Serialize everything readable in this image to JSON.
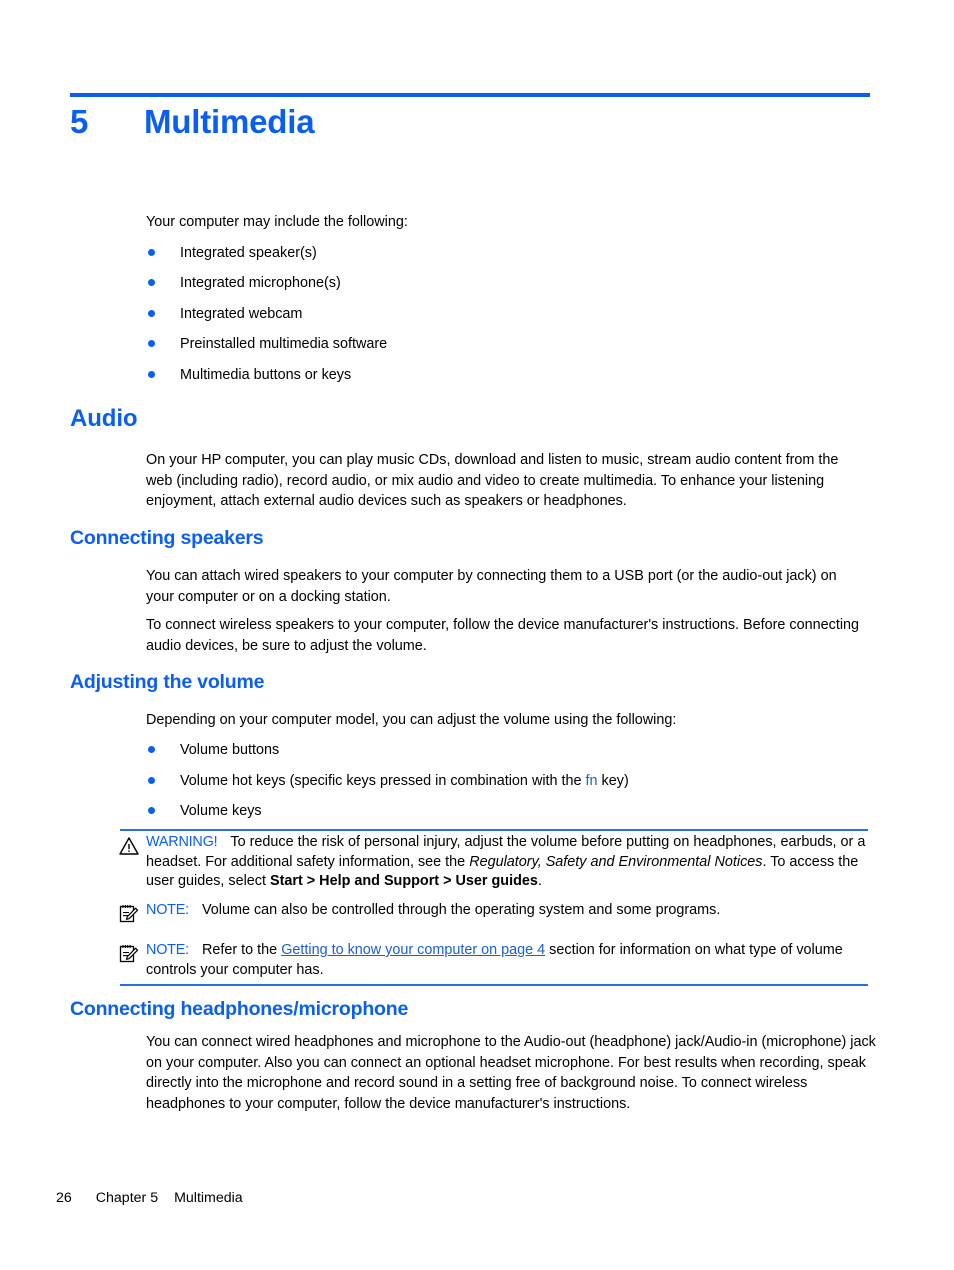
{
  "colors": {
    "accent_blue": "#0a5ff0",
    "link_blue": "#1b5fd0",
    "rule_blue": "#2a6fdb",
    "body_black": "#000000"
  },
  "chapter": {
    "number": "5",
    "title": "Multimedia"
  },
  "intro": {
    "lead": "Your computer may include the following:",
    "bullets": [
      "Integrated speaker(s)",
      "Integrated microphone(s)",
      "Integrated webcam",
      "Preinstalled multimedia software",
      "Multimedia buttons or keys"
    ]
  },
  "audio": {
    "heading": "Audio",
    "paragraph": "On your HP computer, you can play music CDs, download and listen to music, stream audio content from the web (including radio), record audio, or mix audio and video to create multimedia. To enhance your listening enjoyment, attach external audio devices such as speakers or headphones."
  },
  "connecting_speakers": {
    "heading": "Connecting speakers",
    "paragraph1": "You can attach wired speakers to your computer by connecting them to a USB port (or the audio-out jack) on your computer or on a docking station.",
    "paragraph2": "To connect wireless speakers to your computer, follow the device manufacturer's instructions. Before connecting audio devices, be sure to adjust the volume."
  },
  "adjusting_volume": {
    "heading": "Adjusting the volume",
    "lead": "Depending on your computer model, you can adjust the volume using the following:",
    "bullets": [
      {
        "before": "Volume buttons",
        "key": "",
        "after": ""
      },
      {
        "before": "Volume hot keys (specific keys pressed in combination with the ",
        "key": "fn",
        "after": " key)"
      },
      {
        "before": "Volume keys",
        "key": "",
        "after": ""
      }
    ]
  },
  "warning": {
    "icon": "warning-triangle-icon",
    "label": "WARNING!",
    "text_part1": "To reduce the risk of personal injury, adjust the volume before putting on headphones, earbuds, or a headset. For additional safety information, see the ",
    "italic_ref": "Regulatory, Safety and Environmental Notices",
    "text_part2": ". To access the user guides, select ",
    "bold_path": "Start > Help and Support > User guides",
    "text_part3": "."
  },
  "note1": {
    "icon": "note-pad-icon",
    "label": "NOTE:",
    "text": "Volume can also be controlled through the operating system and some programs."
  },
  "note2": {
    "icon": "note-pad-icon",
    "label": "NOTE:",
    "text_part1": "Refer to the ",
    "link_text": "Getting to know your computer on page 4",
    "text_part2": " section for information on what type of volume controls your computer has."
  },
  "connecting_headphones": {
    "heading": "Connecting headphones/microphone",
    "paragraph": "You can connect wired headphones and microphone to the Audio-out (headphone) jack/Audio-in (microphone) jack on your computer. Also you can connect an optional headset microphone. For best results when recording, speak directly into the microphone and record sound in a setting free of background noise. To connect wireless headphones to your computer, follow the device manufacturer's instructions."
  },
  "footer": {
    "page_number": "26",
    "chapter_label": "Chapter 5",
    "chapter_title": "Multimedia"
  }
}
